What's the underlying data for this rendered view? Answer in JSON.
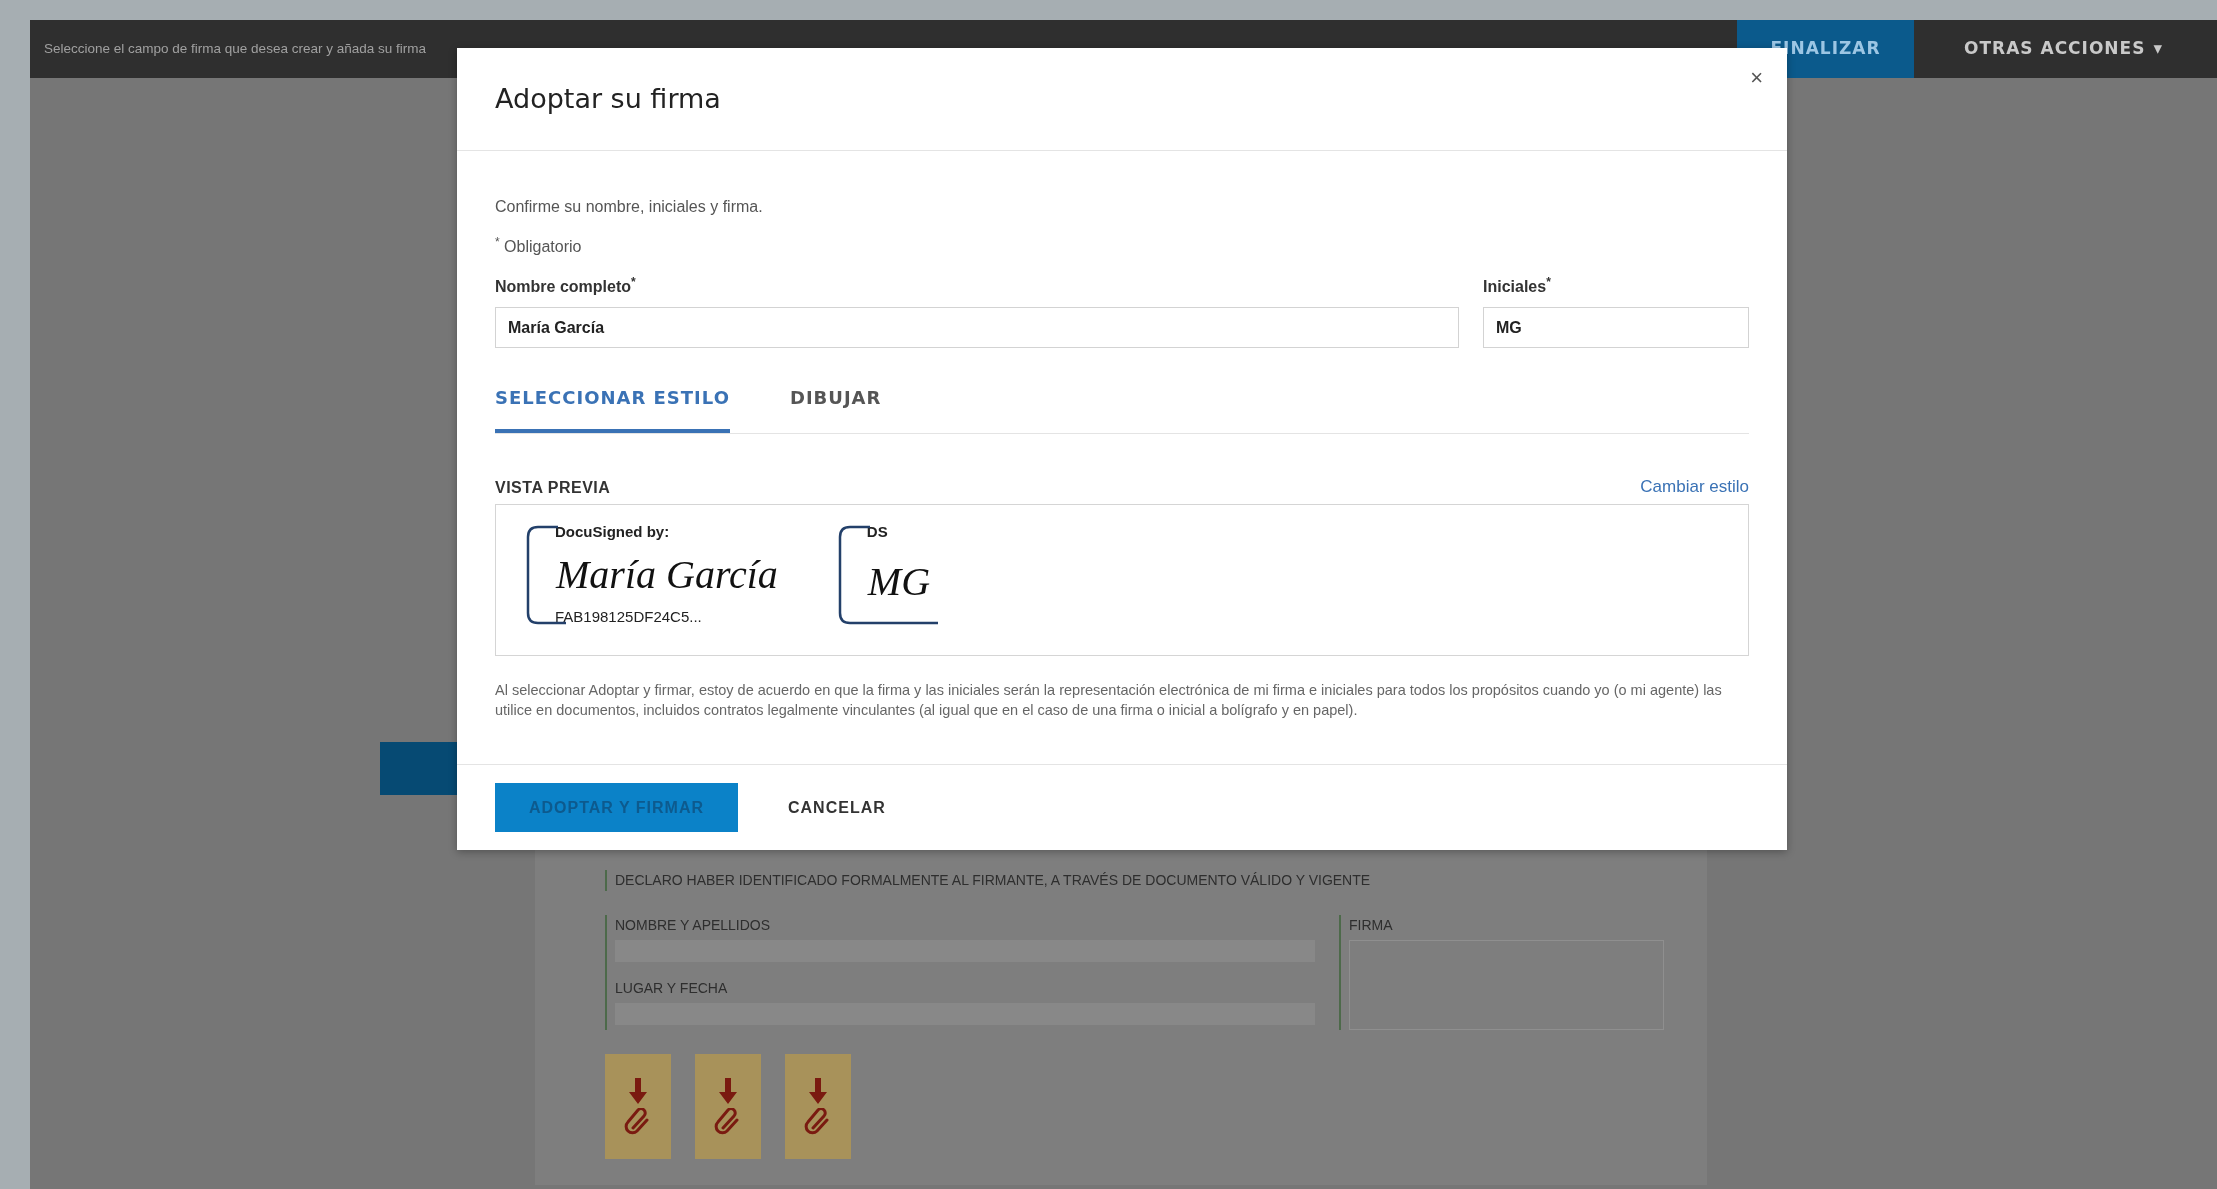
{
  "top_bar": {
    "instruction": "Seleccione el campo de firma que desea crear y añada su firma",
    "finish_button": "FINALIZAR",
    "more_actions": "OTRAS ACCIONES",
    "more_actions_caret": "▾"
  },
  "document": {
    "declaration": "DECLARO HABER IDENTIFICADO FORMALMENTE AL FIRMANTE, A TRAVÉS DE DOCUMENTO VÁLIDO Y VIGENTE",
    "fields": [
      {
        "label": "NOMBRE Y APELLIDOS"
      },
      {
        "label": "LUGAR Y FECHA"
      }
    ],
    "signature_label": "FIRMA",
    "attachments": [
      {
        "kind": "download"
      },
      {
        "kind": "download"
      },
      {
        "kind": "download"
      }
    ]
  },
  "dialog": {
    "title": "Adoptar su firma",
    "close": "×",
    "intro": "Confirme su nombre, iniciales y firma.",
    "required_note": "$^{*}$ Obligatorio",
    "fields": [
      {
        "label": "Nombre completo$^{*}$",
        "value": "María García"
      },
      {
        "label": "Iniciales$^{*}$",
        "value": "MG"
      }
    ],
    "tabs": [
      {
        "label": "SELECCIONAR ESTILO",
        "selected": true
      },
      {
        "label": "DIBUJAR",
        "selected": false
      }
    ],
    "preview_label": "VISTA PREVIA",
    "change_style": "Cambiar estilo",
    "signature": {
      "header": "DocuSigned by:",
      "name": "María García",
      "footer": "FAB198125DF24C5..."
    },
    "initials": {
      "header": "DS",
      "name": "MG"
    },
    "legal_text": "Al seleccionar Adoptar y firmar, estoy de acuerdo en que la firma y las iniciales serán la representación electrónica de mi firma e iniciales para todos los propósitos cuando yo (o mi agente) las utilice en documentos, incluidos contratos legalmente vinculantes (al igual que en el caso de una firma o inicial a bolígrafo y en papel).",
    "buttons": [
      {
        "label": "ADOPTAR Y FIRMAR",
        "kind": "primary"
      },
      {
        "label": "CANCELAR",
        "kind": "link"
      }
    ]
  }
}
